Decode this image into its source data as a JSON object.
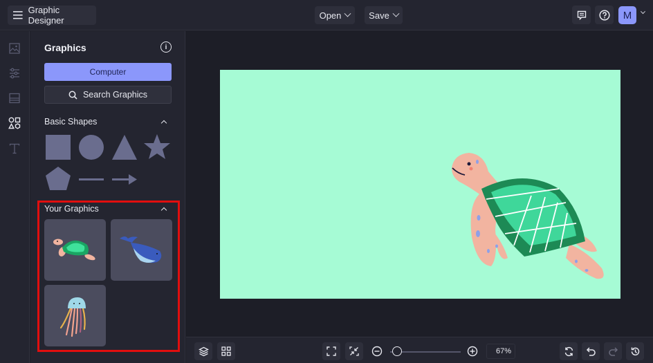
{
  "app": {
    "title": "Graphic Designer",
    "menu_icon": "hamburger-menu-icon"
  },
  "header": {
    "open_label": "Open",
    "save_label": "Save",
    "feedback_icon": "message-icon",
    "help_icon": "help-circle-icon",
    "avatar_initial": "M"
  },
  "rail": {
    "items": [
      {
        "name": "image-icon",
        "active": false
      },
      {
        "name": "adjustments-icon",
        "active": false
      },
      {
        "name": "layout-icon",
        "active": false
      },
      {
        "name": "shapes-icon",
        "active": true
      },
      {
        "name": "text-icon",
        "active": false
      }
    ]
  },
  "panel": {
    "title": "Graphics",
    "computer_label": "Computer",
    "search_label": "Search Graphics",
    "basic_shapes_label": "Basic Shapes",
    "shapes": [
      "square",
      "circle",
      "triangle",
      "star",
      "pentagon",
      "line",
      "arrow"
    ],
    "your_graphics_label": "Your Graphics",
    "graphics": [
      "sea turtle",
      "whale",
      "jellyfish"
    ]
  },
  "canvas": {
    "background": "#a6fbd5",
    "graphic": "sea turtle"
  },
  "footer": {
    "zoom_value": "67%",
    "zoom_fraction": 0.1
  },
  "colors": {
    "accent": "#8b97fb",
    "highlight": "#e10e0e"
  }
}
